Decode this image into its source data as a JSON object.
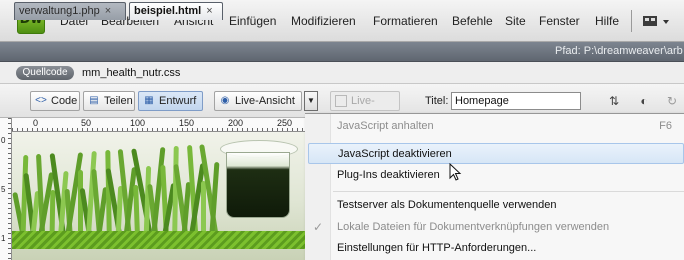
{
  "app": {
    "logo_text": "Dw"
  },
  "menubar": {
    "items": [
      "Datei",
      "Bearbeiten",
      "Ansicht",
      "Einfügen",
      "Modifizieren",
      "Formatieren",
      "Befehle",
      "Site",
      "Fenster",
      "Hilfe"
    ]
  },
  "tabs": [
    {
      "label": "verwaltung1.php",
      "active": false,
      "close": "×"
    },
    {
      "label": "beispiel.html",
      "active": true,
      "close": "×"
    }
  ],
  "path": {
    "text": "Pfad:  P:\\dreamweaver\\arb"
  },
  "related_files": {
    "source_label": "Quellcode",
    "file": "mm_health_nutr.css"
  },
  "toolbar": {
    "code_label": "Code",
    "split_label": "Teilen",
    "design_label": "Entwurf",
    "live_view_label": "Live-Ansicht",
    "live_code_label": "Live-Code",
    "title_label": "Titel:",
    "title_value": "Homepage"
  },
  "ruler": {
    "marks": [
      "0",
      "50",
      "100",
      "150",
      "200",
      "250"
    ],
    "vmarks": [
      "0",
      "5",
      "1"
    ]
  },
  "dropdown_menu": {
    "items": [
      {
        "label": "JavaScript anhalten",
        "shortcut": "F6",
        "disabled": true,
        "checked": false,
        "highlighted": false
      },
      {
        "label": "JavaScript deaktivieren",
        "shortcut": "",
        "disabled": false,
        "checked": false,
        "highlighted": true
      },
      {
        "label": "Plug-Ins deaktivieren",
        "shortcut": "",
        "disabled": false,
        "checked": false,
        "highlighted": false
      },
      {
        "label": "Testserver als Dokumentenquelle verwenden",
        "shortcut": "",
        "disabled": false,
        "checked": false,
        "highlighted": false
      },
      {
        "label": "Lokale Dateien für Dokumentverknüpfungen verwenden",
        "shortcut": "",
        "disabled": true,
        "checked": true,
        "highlighted": false
      },
      {
        "label": "Einstellungen für HTTP-Anforderungen...",
        "shortcut": "",
        "disabled": false,
        "checked": false,
        "highlighted": false
      }
    ],
    "check_glyph": "✓"
  },
  "colors": {
    "accent_highlight": "#d7e6f6",
    "logo_green": "#7cc02e",
    "tab_bar": "#6d747e"
  }
}
